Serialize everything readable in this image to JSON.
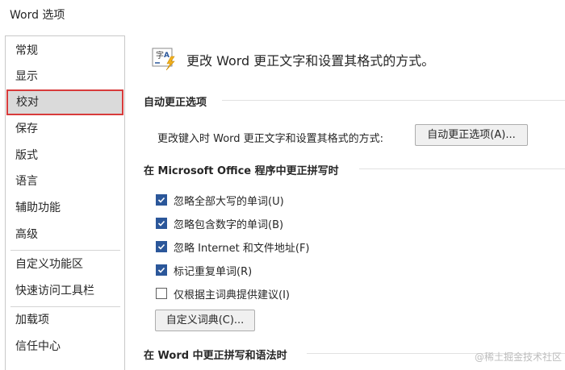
{
  "window": {
    "title": "Word 选项"
  },
  "sidebar": {
    "items": [
      {
        "label": "常规"
      },
      {
        "label": "显示"
      },
      {
        "label": "校对",
        "selected": true
      },
      {
        "label": "保存"
      },
      {
        "label": "版式"
      },
      {
        "label": "语言"
      },
      {
        "label": "辅助功能"
      },
      {
        "label": "高级"
      },
      {
        "label": "自定义功能区"
      },
      {
        "label": "快速访问工具栏"
      },
      {
        "label": "加载项"
      },
      {
        "label": "信任中心"
      }
    ]
  },
  "header": {
    "icon": "abc-proofing-icon",
    "text": "更改 Word 更正文字和设置其格式的方式。"
  },
  "autocorrect": {
    "heading": "自动更正选项",
    "description": "更改键入时 Word 更正文字和设置其格式的方式:",
    "button": "自动更正选项(A)..."
  },
  "office_spelling": {
    "heading": "在 Microsoft Office 程序中更正拼写时",
    "options": [
      {
        "label": "忽略全部大写的单词(U)",
        "checked": true
      },
      {
        "label": "忽略包含数字的单词(B)",
        "checked": true
      },
      {
        "label": "忽略 Internet 和文件地址(F)",
        "checked": true
      },
      {
        "label": "标记重复单词(R)",
        "checked": true
      },
      {
        "label": "仅根据主词典提供建议(I)",
        "checked": false
      }
    ],
    "dictionary_button": "自定义词典(C)..."
  },
  "word_spelling": {
    "heading": "在 Word 中更正拼写和语法时"
  },
  "watermark": "@稀土掘金技术社区",
  "colors": {
    "accent": "#2b579a",
    "selected_border": "#d83b3b",
    "selected_bg": "#dadada"
  }
}
